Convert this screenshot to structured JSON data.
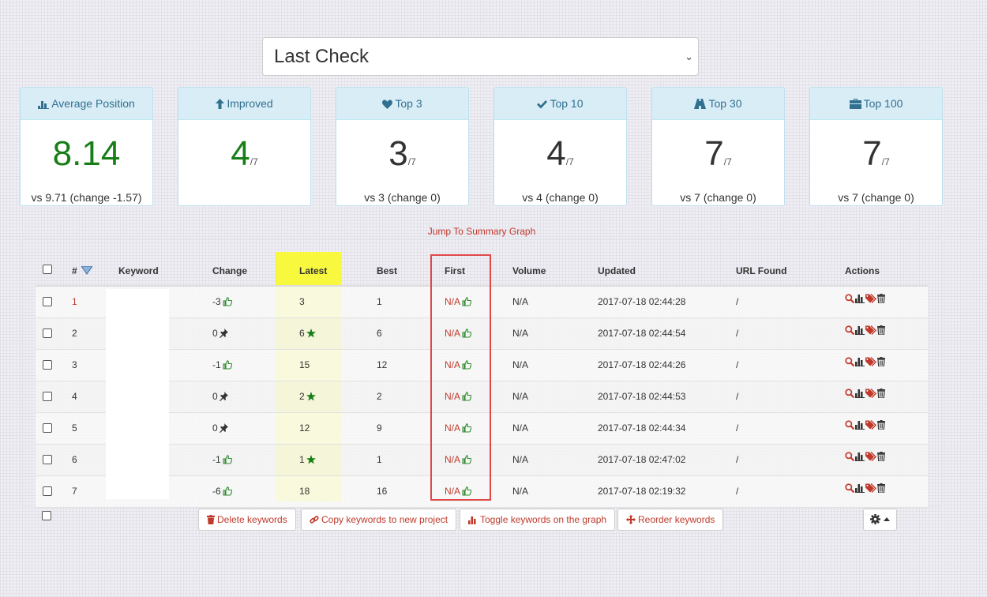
{
  "period_select": {
    "value": "Last Check"
  },
  "cards": [
    {
      "label": "Average Position",
      "icon": "bar-chart-icon",
      "value": "8.14",
      "denominator": "",
      "footer": "vs 9.71 (change -1.57)",
      "color": "green"
    },
    {
      "label": "Improved",
      "icon": "arrow-up-icon",
      "value": "4",
      "denominator": "/7",
      "footer": "",
      "color": "green"
    },
    {
      "label": "Top 3",
      "icon": "heart-icon",
      "value": "3",
      "denominator": "/7",
      "footer": "vs 3 (change 0)",
      "color": "dark"
    },
    {
      "label": "Top 10",
      "icon": "check-icon",
      "value": "4",
      "denominator": "/7",
      "footer": "vs 4 (change 0)",
      "color": "dark"
    },
    {
      "label": "Top 30",
      "icon": "road-icon",
      "value": "7",
      "denominator": "/7",
      "footer": "vs 7 (change 0)",
      "color": "dark"
    },
    {
      "label": "Top 100",
      "icon": "briefcase-icon",
      "value": "7",
      "denominator": "/7",
      "footer": "vs 7 (change 0)",
      "color": "dark"
    }
  ],
  "jump_link": "Jump To Summary Graph",
  "table": {
    "headers": {
      "num": "#",
      "keyword": "Keyword",
      "change": "Change",
      "latest": "Latest",
      "best": "Best",
      "first": "First",
      "volume": "Volume",
      "updated": "Updated",
      "url": "URL Found",
      "actions": "Actions"
    },
    "rows": [
      {
        "num": "1",
        "keyword": "",
        "change": "-3",
        "change_icon": "thumbs-up-icon",
        "latest": "3",
        "latest_star": false,
        "best": "1",
        "first": "N/A",
        "volume": "N/A",
        "updated": "2017-07-18 02:44:28",
        "url": "/"
      },
      {
        "num": "2",
        "keyword": "",
        "change": "0",
        "change_icon": "pin-icon",
        "latest": "6",
        "latest_star": true,
        "best": "6",
        "first": "N/A",
        "volume": "N/A",
        "updated": "2017-07-18 02:44:54",
        "url": "/"
      },
      {
        "num": "3",
        "keyword": "",
        "change": "-1",
        "change_icon": "thumbs-up-icon",
        "latest": "15",
        "latest_star": false,
        "best": "12",
        "first": "N/A",
        "volume": "N/A",
        "updated": "2017-07-18 02:44:26",
        "url": "/"
      },
      {
        "num": "4",
        "keyword": "",
        "change": "0",
        "change_icon": "pin-icon",
        "latest": "2",
        "latest_star": true,
        "best": "2",
        "first": "N/A",
        "volume": "N/A",
        "updated": "2017-07-18 02:44:53",
        "url": "/"
      },
      {
        "num": "5",
        "keyword": "",
        "change": "0",
        "change_icon": "pin-icon",
        "latest": "12",
        "latest_star": false,
        "best": "9",
        "first": "N/A",
        "volume": "N/A",
        "updated": "2017-07-18 02:44:34",
        "url": "/"
      },
      {
        "num": "6",
        "keyword": "",
        "change": "-1",
        "change_icon": "thumbs-up-icon",
        "latest": "1",
        "latest_star": true,
        "best": "1",
        "first": "N/A",
        "volume": "N/A",
        "updated": "2017-07-18 02:47:02",
        "url": "/"
      },
      {
        "num": "7",
        "keyword": "",
        "change": "-6",
        "change_icon": "thumbs-up-icon",
        "latest": "18",
        "latest_star": false,
        "best": "16",
        "first": "N/A",
        "volume": "N/A",
        "updated": "2017-07-18 02:19:32",
        "url": "/"
      }
    ]
  },
  "buttons": {
    "delete": "Delete keywords",
    "copy": "Copy keywords to new project",
    "toggle": "Toggle keywords on the graph",
    "reorder": "Reorder keywords"
  },
  "colors": {
    "accent_red": "#c0392b",
    "green": "#177e17",
    "card_head_bg": "#d9edf7",
    "card_head_text": "#31708f",
    "highlight_yellow": "#f8f83f",
    "first_box_red": "#e04747"
  }
}
